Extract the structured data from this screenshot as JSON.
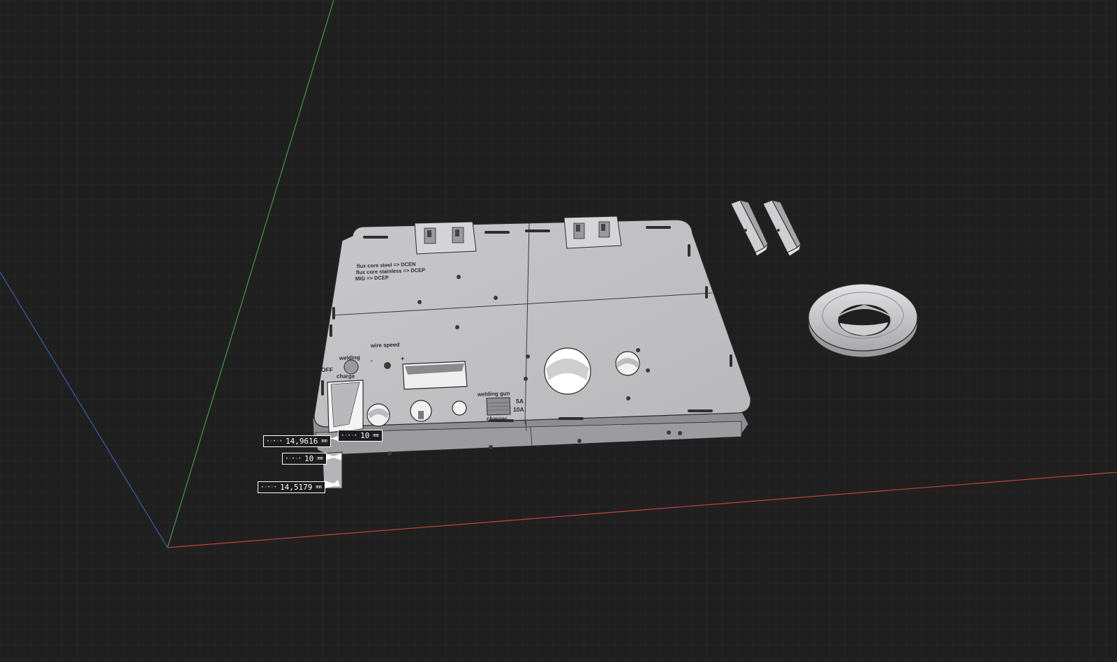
{
  "viewport": {
    "background": "#1f1f20",
    "axis_colors": {
      "x": "#c0433a",
      "y": "#3f9a46",
      "z": "#3a5fa8"
    }
  },
  "model": {
    "plate_color": "#bdbdc0",
    "labels": {
      "polarity_line1": "flux core steel => DCEN",
      "polarity_line2": "flux core stainless => DCEP",
      "polarity_line3": "MIG => DCEP",
      "wire_speed": "wire speed",
      "minus": "-",
      "plus": "+",
      "welding": "welding",
      "off": "OFF",
      "charge": "charge",
      "welding_gun": "welding gun",
      "amp_5": "5A",
      "amp_10": "10A",
      "charger": "charger"
    }
  },
  "dimensions": [
    {
      "name": "dimension-a",
      "value": "14,9616",
      "unit": "mm",
      "icon": "measure-handle-icon"
    },
    {
      "name": "dimension-b",
      "value": "10",
      "unit": "mm",
      "icon": "measure-handle-icon"
    },
    {
      "name": "dimension-c",
      "value": "10",
      "unit": "mm",
      "icon": "measure-handle-icon"
    },
    {
      "name": "dimension-d",
      "value": "14,5179",
      "unit": "mm",
      "icon": "measure-handle-icon"
    }
  ]
}
